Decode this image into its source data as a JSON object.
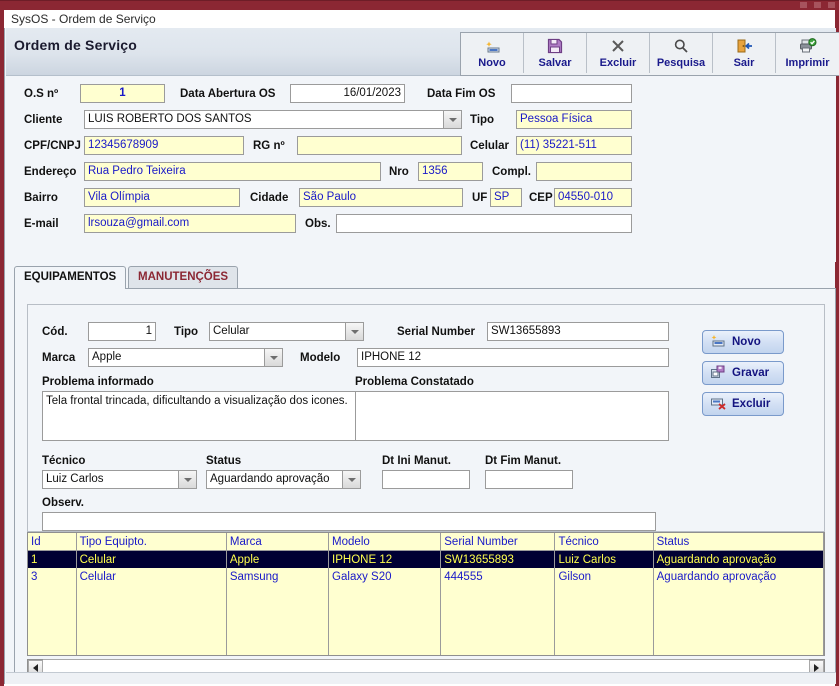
{
  "window": {
    "title": "SysOS - Ordem de Serviço",
    "controls": [
      "minimize",
      "maximize",
      "close"
    ]
  },
  "header": {
    "title": "Ordem de Serviço"
  },
  "toolbar": {
    "buttons": [
      {
        "label": "Novo",
        "icon": "new-record-icon"
      },
      {
        "label": "Salvar",
        "icon": "floppy-disk-icon"
      },
      {
        "label": "Excluir",
        "icon": "x-cross-icon"
      },
      {
        "label": "Pesquisa",
        "icon": "magnifier-icon"
      },
      {
        "label": "Sair",
        "icon": "exit-door-icon"
      },
      {
        "label": "Imprimir",
        "icon": "printer-check-icon"
      }
    ]
  },
  "form": {
    "os_numero": {
      "label": "O.S nº",
      "value": "1"
    },
    "data_abertura": {
      "label": "Data Abertura OS",
      "value": "16/01/2023"
    },
    "data_fim": {
      "label": "Data Fim OS",
      "value": ""
    },
    "cliente": {
      "label": "Cliente",
      "value": "LUIS ROBERTO DOS SANTOS"
    },
    "tipo": {
      "label": "Tipo",
      "value": "Pessoa Física"
    },
    "cpf_cnpj": {
      "label": "CPF/CNPJ",
      "value": "12345678909"
    },
    "rg": {
      "label": "RG nº",
      "value": ""
    },
    "celular": {
      "label": "Celular",
      "value": "(11) 35221-511"
    },
    "endereco": {
      "label": "Endereço",
      "value": "Rua Pedro Teixeira"
    },
    "nro": {
      "label": "Nro",
      "value": "1356"
    },
    "compl": {
      "label": "Compl.",
      "value": ""
    },
    "bairro": {
      "label": "Bairro",
      "value": "Vila Olímpia"
    },
    "cidade": {
      "label": "Cidade",
      "value": "São Paulo"
    },
    "uf": {
      "label": "UF",
      "value": "SP"
    },
    "cep": {
      "label": "CEP",
      "value": "04550-010"
    },
    "email": {
      "label": "E-mail",
      "value": "lrsouza@gmail.com"
    },
    "obs": {
      "label": "Obs.",
      "value": ""
    }
  },
  "tabs": [
    {
      "label": "EQUIPAMENTOS",
      "active": true
    },
    {
      "label": "MANUTENÇÕES",
      "active": false
    }
  ],
  "equipment": {
    "cod": {
      "label": "Cód.",
      "value": "1"
    },
    "tipo": {
      "label": "Tipo",
      "value": "Celular"
    },
    "serial": {
      "label": "Serial Number",
      "value": "SW13655893"
    },
    "marca": {
      "label": "Marca",
      "value": "Apple"
    },
    "modelo": {
      "label": "Modelo",
      "value": "IPHONE 12"
    },
    "prob_informado": {
      "label": "Problema informado",
      "value": "Tela frontal trincada, dificultando a visualização dos icones."
    },
    "prob_constatado": {
      "label": "Problema Constatado",
      "value": ""
    },
    "tecnico": {
      "label": "Técnico",
      "value": "Luiz Carlos"
    },
    "status": {
      "label": "Status",
      "value": "Aguardando aprovação"
    },
    "dt_ini": {
      "label": "Dt Ini Manut.",
      "value": ""
    },
    "dt_fim": {
      "label": "Dt Fim Manut.",
      "value": ""
    },
    "observ": {
      "label": "Observ.",
      "value": ""
    },
    "buttons": [
      {
        "label": "Novo",
        "icon": "new-record-icon"
      },
      {
        "label": "Gravar",
        "icon": "floppy-disk-icon"
      },
      {
        "label": "Excluir",
        "icon": "delete-record-icon"
      }
    ]
  },
  "grid": {
    "columns": [
      "Id",
      "Tipo Equipto.",
      "Marca",
      "Modelo",
      "Serial Number",
      "Técnico",
      "Status"
    ],
    "rows": [
      {
        "selected": true,
        "cells": [
          "1",
          "Celular",
          "Apple",
          "IPHONE 12",
          "SW13655893",
          "Luiz Carlos",
          "Aguardando aprovação"
        ]
      },
      {
        "selected": false,
        "cells": [
          "3",
          "Celular",
          "Samsung",
          "Galaxy S20",
          "444555",
          "Gilson",
          "Aguardando aprovação"
        ]
      }
    ]
  },
  "colors": {
    "window_border": "#8b2733",
    "field_yellow": "#ffffd0",
    "field_text_blue": "#1919c8",
    "selection_bg": "#000033",
    "selection_fg": "#ffff4d",
    "tab_inactive_text": "#8b2733",
    "button_label_blue": "#1a1a8c"
  }
}
